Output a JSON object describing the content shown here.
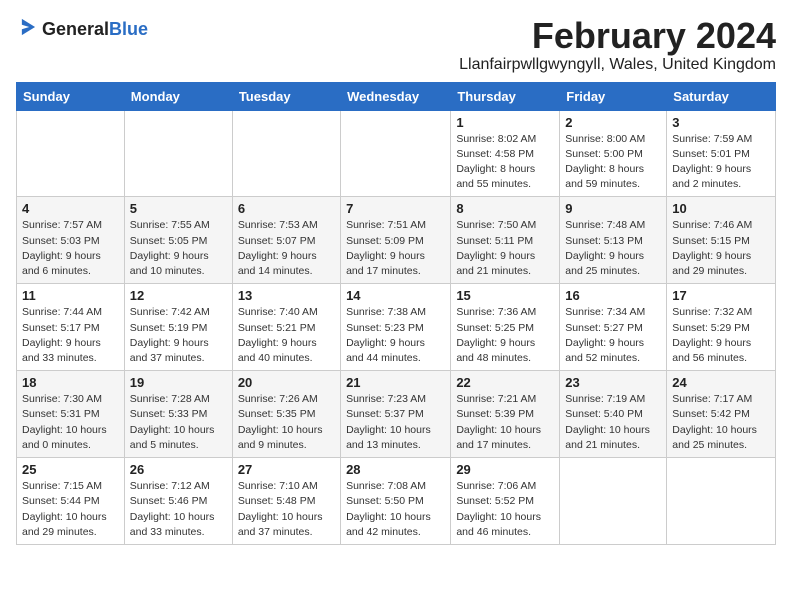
{
  "logo": {
    "line1": "General",
    "line2": "Blue"
  },
  "title": "February 2024",
  "subtitle": "Llanfairpwllgwyngyll, Wales, United Kingdom",
  "header_color": "#2a6dc4",
  "days_of_week": [
    "Sunday",
    "Monday",
    "Tuesday",
    "Wednesday",
    "Thursday",
    "Friday",
    "Saturday"
  ],
  "weeks": [
    [
      {
        "day": "",
        "info": ""
      },
      {
        "day": "",
        "info": ""
      },
      {
        "day": "",
        "info": ""
      },
      {
        "day": "",
        "info": ""
      },
      {
        "day": "1",
        "info": "Sunrise: 8:02 AM\nSunset: 4:58 PM\nDaylight: 8 hours\nand 55 minutes."
      },
      {
        "day": "2",
        "info": "Sunrise: 8:00 AM\nSunset: 5:00 PM\nDaylight: 8 hours\nand 59 minutes."
      },
      {
        "day": "3",
        "info": "Sunrise: 7:59 AM\nSunset: 5:01 PM\nDaylight: 9 hours\nand 2 minutes."
      }
    ],
    [
      {
        "day": "4",
        "info": "Sunrise: 7:57 AM\nSunset: 5:03 PM\nDaylight: 9 hours\nand 6 minutes."
      },
      {
        "day": "5",
        "info": "Sunrise: 7:55 AM\nSunset: 5:05 PM\nDaylight: 9 hours\nand 10 minutes."
      },
      {
        "day": "6",
        "info": "Sunrise: 7:53 AM\nSunset: 5:07 PM\nDaylight: 9 hours\nand 14 minutes."
      },
      {
        "day": "7",
        "info": "Sunrise: 7:51 AM\nSunset: 5:09 PM\nDaylight: 9 hours\nand 17 minutes."
      },
      {
        "day": "8",
        "info": "Sunrise: 7:50 AM\nSunset: 5:11 PM\nDaylight: 9 hours\nand 21 minutes."
      },
      {
        "day": "9",
        "info": "Sunrise: 7:48 AM\nSunset: 5:13 PM\nDaylight: 9 hours\nand 25 minutes."
      },
      {
        "day": "10",
        "info": "Sunrise: 7:46 AM\nSunset: 5:15 PM\nDaylight: 9 hours\nand 29 minutes."
      }
    ],
    [
      {
        "day": "11",
        "info": "Sunrise: 7:44 AM\nSunset: 5:17 PM\nDaylight: 9 hours\nand 33 minutes."
      },
      {
        "day": "12",
        "info": "Sunrise: 7:42 AM\nSunset: 5:19 PM\nDaylight: 9 hours\nand 37 minutes."
      },
      {
        "day": "13",
        "info": "Sunrise: 7:40 AM\nSunset: 5:21 PM\nDaylight: 9 hours\nand 40 minutes."
      },
      {
        "day": "14",
        "info": "Sunrise: 7:38 AM\nSunset: 5:23 PM\nDaylight: 9 hours\nand 44 minutes."
      },
      {
        "day": "15",
        "info": "Sunrise: 7:36 AM\nSunset: 5:25 PM\nDaylight: 9 hours\nand 48 minutes."
      },
      {
        "day": "16",
        "info": "Sunrise: 7:34 AM\nSunset: 5:27 PM\nDaylight: 9 hours\nand 52 minutes."
      },
      {
        "day": "17",
        "info": "Sunrise: 7:32 AM\nSunset: 5:29 PM\nDaylight: 9 hours\nand 56 minutes."
      }
    ],
    [
      {
        "day": "18",
        "info": "Sunrise: 7:30 AM\nSunset: 5:31 PM\nDaylight: 10 hours\nand 0 minutes."
      },
      {
        "day": "19",
        "info": "Sunrise: 7:28 AM\nSunset: 5:33 PM\nDaylight: 10 hours\nand 5 minutes."
      },
      {
        "day": "20",
        "info": "Sunrise: 7:26 AM\nSunset: 5:35 PM\nDaylight: 10 hours\nand 9 minutes."
      },
      {
        "day": "21",
        "info": "Sunrise: 7:23 AM\nSunset: 5:37 PM\nDaylight: 10 hours\nand 13 minutes."
      },
      {
        "day": "22",
        "info": "Sunrise: 7:21 AM\nSunset: 5:39 PM\nDaylight: 10 hours\nand 17 minutes."
      },
      {
        "day": "23",
        "info": "Sunrise: 7:19 AM\nSunset: 5:40 PM\nDaylight: 10 hours\nand 21 minutes."
      },
      {
        "day": "24",
        "info": "Sunrise: 7:17 AM\nSunset: 5:42 PM\nDaylight: 10 hours\nand 25 minutes."
      }
    ],
    [
      {
        "day": "25",
        "info": "Sunrise: 7:15 AM\nSunset: 5:44 PM\nDaylight: 10 hours\nand 29 minutes."
      },
      {
        "day": "26",
        "info": "Sunrise: 7:12 AM\nSunset: 5:46 PM\nDaylight: 10 hours\nand 33 minutes."
      },
      {
        "day": "27",
        "info": "Sunrise: 7:10 AM\nSunset: 5:48 PM\nDaylight: 10 hours\nand 37 minutes."
      },
      {
        "day": "28",
        "info": "Sunrise: 7:08 AM\nSunset: 5:50 PM\nDaylight: 10 hours\nand 42 minutes."
      },
      {
        "day": "29",
        "info": "Sunrise: 7:06 AM\nSunset: 5:52 PM\nDaylight: 10 hours\nand 46 minutes."
      },
      {
        "day": "",
        "info": ""
      },
      {
        "day": "",
        "info": ""
      }
    ]
  ]
}
